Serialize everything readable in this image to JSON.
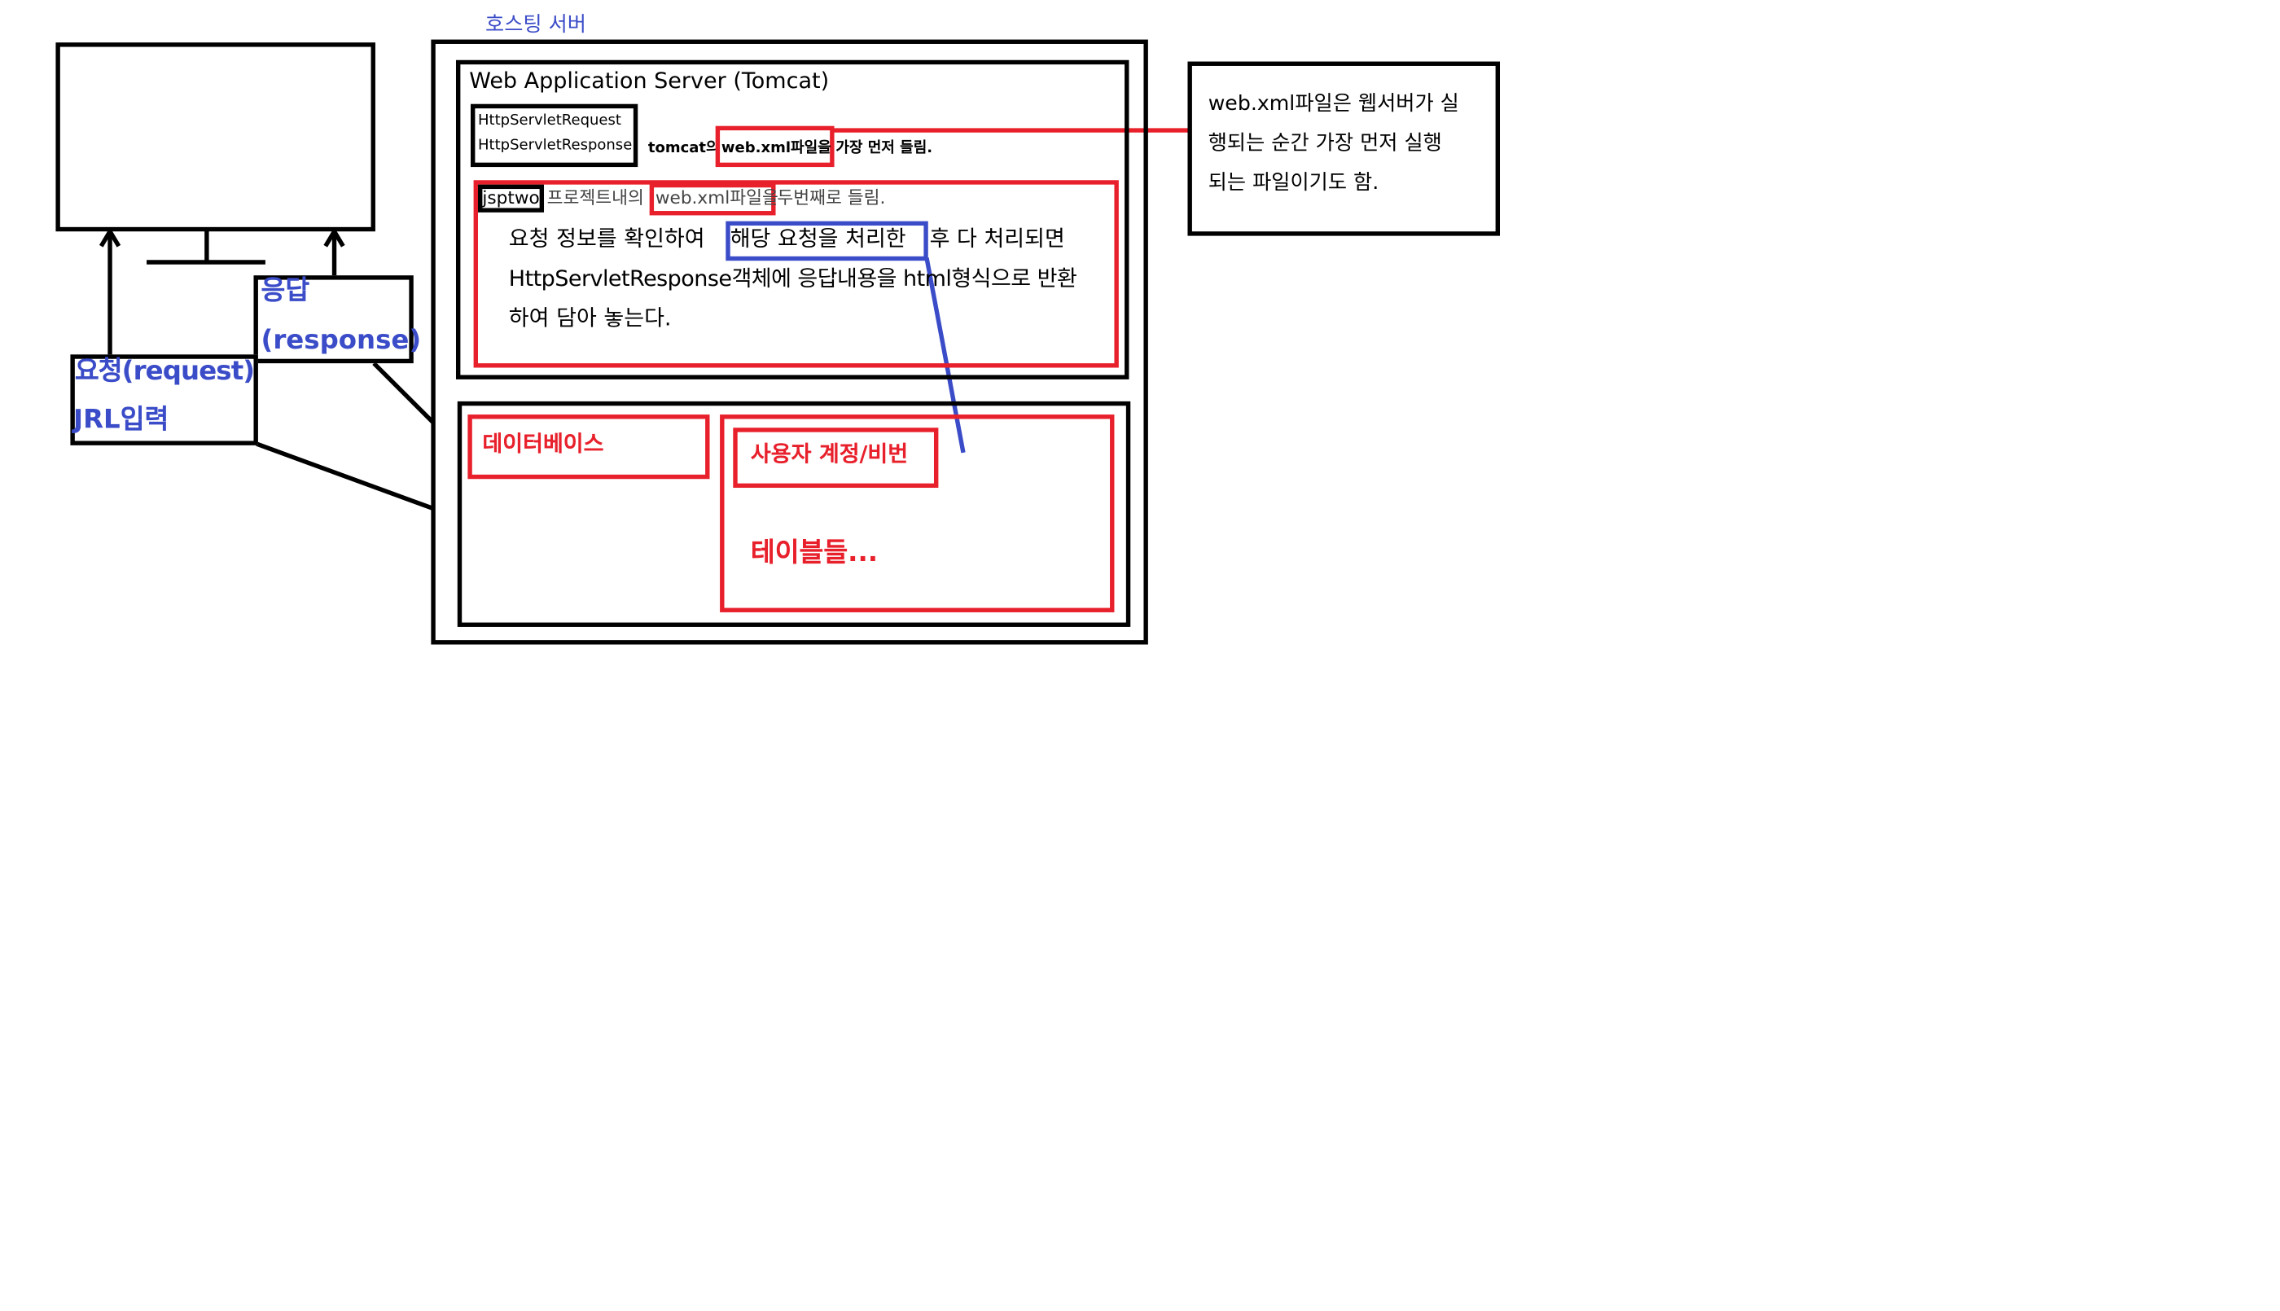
{
  "client": {
    "request_line1": "요청(request)",
    "request_line2": "JRL입력",
    "response_line1": "응답",
    "response_line2": "(response)"
  },
  "server": {
    "hosting_title": "호스팅 서버",
    "was_title": "Web Application Server (Tomcat)",
    "servlet_request": "HttpServletRequest",
    "servlet_response": "HttpServletResponse",
    "tomcat_prefix": "tomcat의",
    "webxml_bold": "web.xml파일을",
    "tomcat_suffix": "가장 먼저 들림.",
    "project_name": "jsptwo",
    "project_mid": "프로젝트내의",
    "webxml_light": "web.xml파일을",
    "project_suffix": "두번째로 들림.",
    "desc_line1_pre": "요청 정보를 확인하여",
    "desc_highlight": "해당 요청을 처리한",
    "desc_line1_post": "후 다 처리되면",
    "desc_line2": "HttpServletResponse객체에 응답내용을 html형식으로 반환",
    "desc_line3": "하여 담아 놓는다."
  },
  "database": {
    "label": "데이터베이스",
    "account_label": "사용자 계정/비번",
    "tables_label": "테이블들..."
  },
  "note": {
    "line1": "web.xml파일은 웹서버가 실",
    "line2": "행되는 순간 가장 먼저 실행",
    "line3": "되는 파일이기도 함."
  },
  "colors": {
    "red": "#e8202b",
    "blue": "#3b4cc8",
    "black": "#000000"
  }
}
